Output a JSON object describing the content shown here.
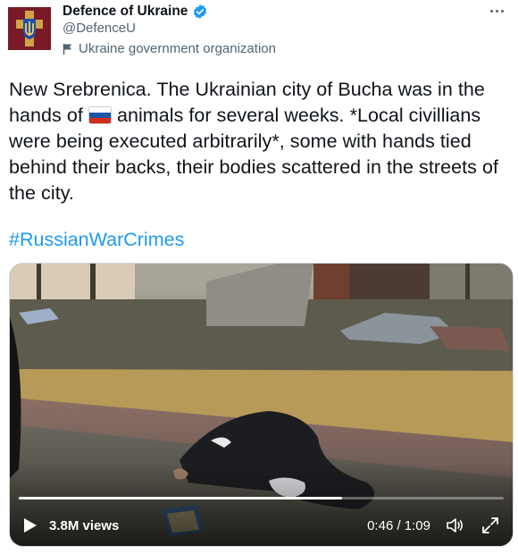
{
  "account": {
    "display_name": "Defence of Ukraine",
    "handle": "@DefenceU",
    "affiliation": "Ukraine government organization",
    "avatar_icon": "ukraine-trident-emblem-icon",
    "verified_icon": "verified-badge-icon",
    "verified_color": "#1d9bf0"
  },
  "menu": {
    "icon": "more-horizontal-icon"
  },
  "tweet": {
    "text_before_flag": "New Srebrenica. The Ukrainian city of Bucha was in the hands of ",
    "flag_icon": "russia-flag-emoji-icon",
    "text_after_flag": " animals for several weeks. *Local civillians were being executed arbitrarily*, some with hands tied behind their backs, their bodies scattered in the streets of the city.",
    "hashtag": "#RussianWarCrimes",
    "hashtag_color": "#1d9bf0"
  },
  "video": {
    "views": "3.8M views",
    "time": "0:46 / 1:09",
    "progress": 0.667,
    "play_icon": "play-icon",
    "volume_icon": "volume-icon",
    "fullscreen_icon": "fullscreen-icon"
  }
}
